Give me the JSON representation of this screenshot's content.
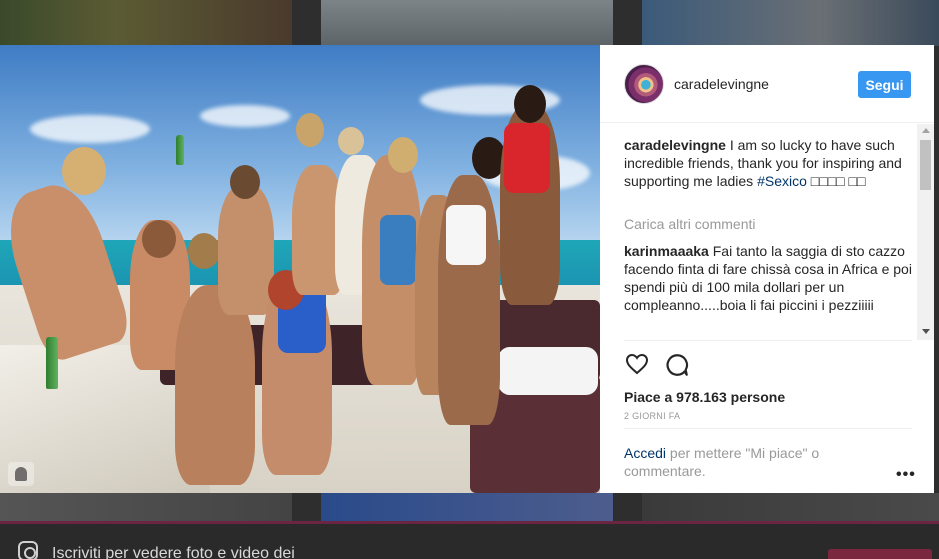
{
  "post": {
    "username": "caradelevingne",
    "follow_label": "Segui",
    "caption": {
      "author": "caradelevingne",
      "text": " I am so lucky to have such incredible friends, thank you for inspiring and supporting me ladies ",
      "hashtag": "#Sexico",
      "emoji": " □□□□ □□"
    },
    "load_more_label": "Carica altri commenti",
    "comments": [
      {
        "author": "karinmaaaka",
        "text": " Fai tanto la saggia di sto cazzo facendo finta di fare chissà cosa in Africa e poi spendi più di 100 mila dollari per un compleanno.....boia li fai piccini i pezziiiii"
      }
    ],
    "likes": "Piace a 978.163 persone",
    "time": "2 GIORNI FA",
    "login": {
      "link": "Accedi",
      "text": " per mettere \"Mi piace\" o commentare."
    },
    "more_label": "•••"
  },
  "background": {
    "signup_prompt": "Iscriviti per vedere foto e video dei"
  },
  "colors": {
    "accent": "#3897f0",
    "link": "#003569",
    "muted": "#999999"
  },
  "icons": [
    "heart-icon",
    "comment-icon",
    "more-options-icon",
    "user-tag-icon",
    "instagram-icon"
  ]
}
